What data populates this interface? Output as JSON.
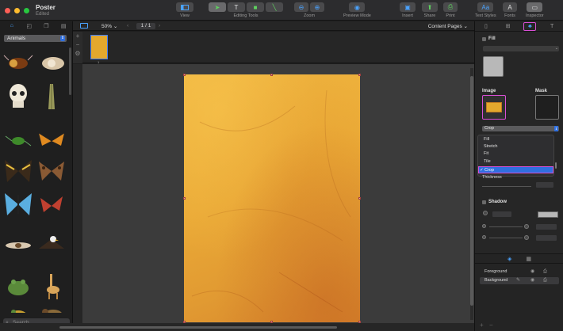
{
  "window": {
    "title": "Poster",
    "subtitle": "Edited"
  },
  "toolbar": {
    "view_label": "View",
    "editing_tools_label": "Editing Tools",
    "zoom_label": "Zoom",
    "preview_label": "Preview Mode",
    "insert_label": "Insert",
    "share_label": "Share",
    "print_label": "Print",
    "text_styles_label": "Text Styles",
    "fonts_label": "Fonts",
    "inspector_label": "Inspector",
    "fonts_glyph": "A"
  },
  "library": {
    "category": "Animals",
    "search_placeholder": "Search",
    "items": [
      "beetle-1",
      "skull-hand",
      "skull",
      "insect-stick",
      "beetle-green",
      "butterfly-orange",
      "butterfly-striped",
      "moth-brown",
      "butterfly-blue",
      "moth-red",
      "insect-winged",
      "eagle",
      "frog",
      "giraffe",
      "frog-yellow",
      "bird"
    ]
  },
  "center": {
    "zoom_value": "50%",
    "page_indicator": "1 / 1",
    "content_pages_label": "Content Pages",
    "page_number": "1"
  },
  "inspector": {
    "fill_title": "Fill",
    "image_title": "Image",
    "mask_title": "Mask",
    "crop_value": "Crop",
    "dropdown_options": [
      {
        "label": "Fill",
        "selected": false
      },
      {
        "label": "Stretch",
        "selected": false
      },
      {
        "label": "Fit",
        "selected": false
      },
      {
        "label": "Tile",
        "selected": false
      },
      {
        "label": "Crop",
        "selected": true
      }
    ],
    "thickness_label": "Thickness",
    "shadow_title": "Shadow",
    "layers": [
      {
        "label": "Foreground",
        "selected": false
      },
      {
        "label": "Background",
        "selected": true
      }
    ]
  },
  "colors": {
    "accent": "#2f6fe0",
    "highlight": "#d94fd6",
    "poster_orange": "#eaa936"
  }
}
